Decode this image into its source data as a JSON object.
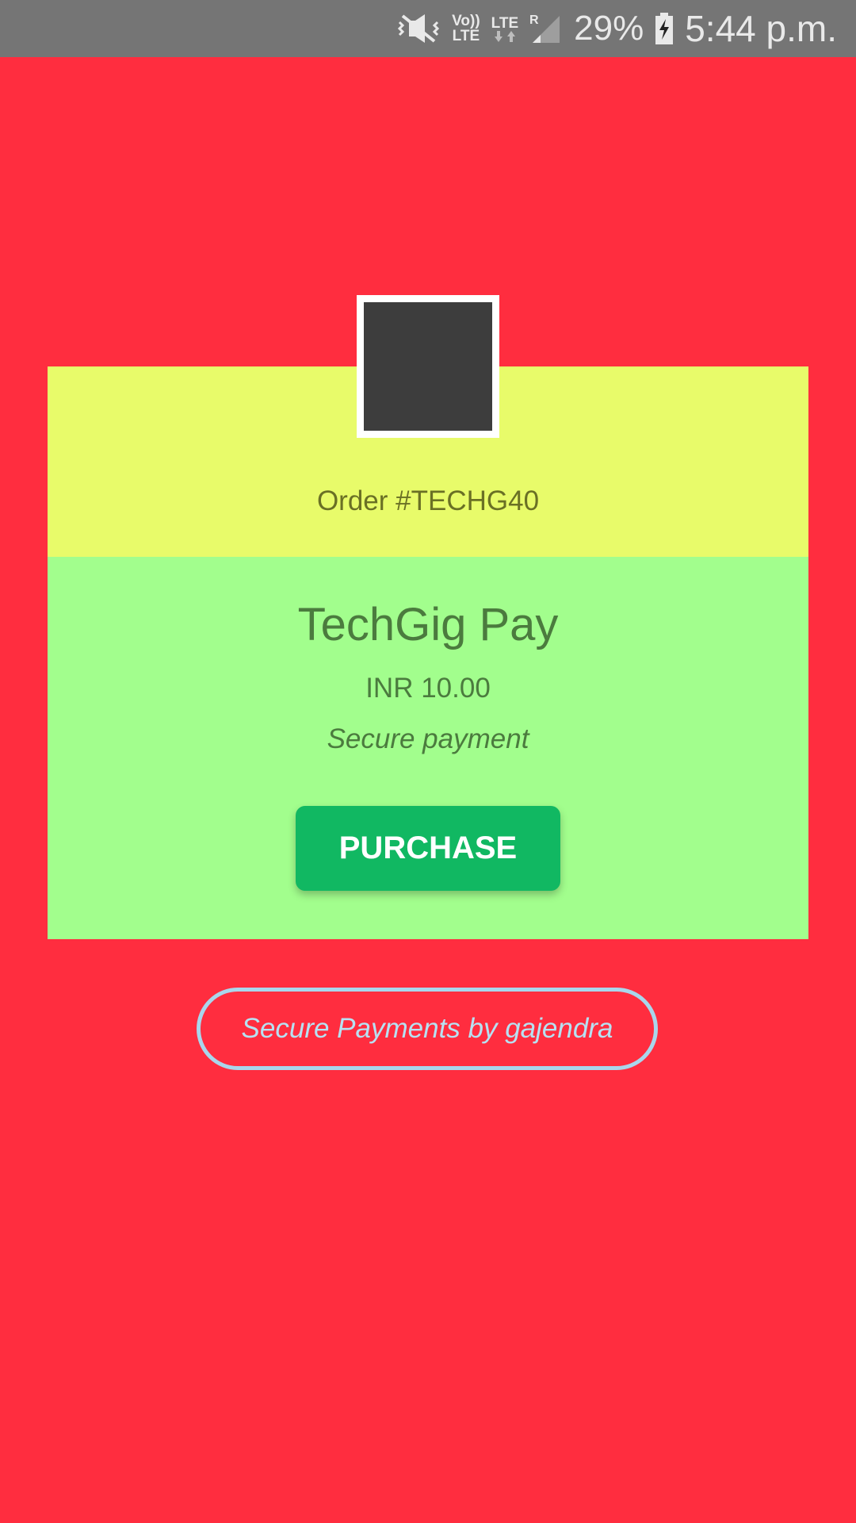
{
  "status_bar": {
    "icons": [
      "vibrate-mute-icon",
      "volte-icon",
      "lte-data-icon",
      "signal-roaming-icon",
      "battery-charging-icon"
    ],
    "volte_top": "Vo))",
    "volte_bottom": "LTE",
    "lte_label": "LTE",
    "roaming_label": "R",
    "battery_percent": "29%",
    "time": "5:44 p.m."
  },
  "order": {
    "label": "Order #TECHG40"
  },
  "merchant": {
    "name": "TechGig Pay",
    "amount": "INR 10.00",
    "tagline": "Secure payment"
  },
  "actions": {
    "purchase_label": "PURCHASE"
  },
  "footer": {
    "powered_by": "Secure Payments by gajendra"
  },
  "colors": {
    "background": "#ff2d3f",
    "header_panel": "#e8fb6a",
    "body_panel": "#a2fe8d",
    "purchase_button": "#11b862",
    "pill_border": "#a9d6ec"
  }
}
